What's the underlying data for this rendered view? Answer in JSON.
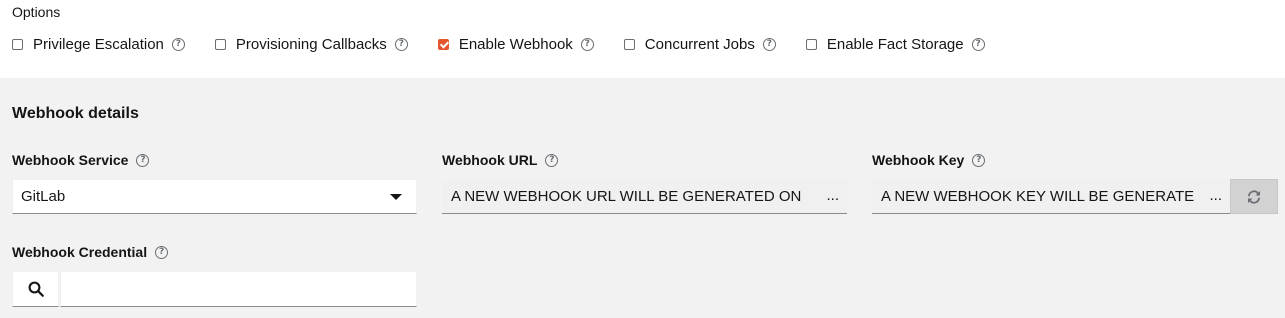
{
  "options": {
    "title": "Options",
    "items": [
      {
        "label": "Privilege Escalation",
        "checked": false
      },
      {
        "label": "Provisioning Callbacks",
        "checked": false
      },
      {
        "label": "Enable Webhook",
        "checked": true
      },
      {
        "label": "Concurrent Jobs",
        "checked": false
      },
      {
        "label": "Enable Fact Storage",
        "checked": false
      }
    ]
  },
  "webhook": {
    "title": "Webhook details",
    "service": {
      "label": "Webhook Service",
      "value": "GitLab"
    },
    "url": {
      "label": "Webhook URL",
      "value": "A NEW WEBHOOK URL WILL BE GENERATED ON",
      "ellipsis": "..."
    },
    "key": {
      "label": "Webhook Key",
      "value": "A NEW WEBHOOK KEY WILL BE GENERATE",
      "ellipsis": "..."
    },
    "credential": {
      "label": "Webhook Credential",
      "value": ""
    }
  },
  "icons": {
    "help": "?",
    "search": "search-icon",
    "refresh": "sync-icon",
    "caret": "caret-down-icon"
  },
  "colors": {
    "accent": "#e4572e",
    "panel": "#f2f2f2"
  }
}
